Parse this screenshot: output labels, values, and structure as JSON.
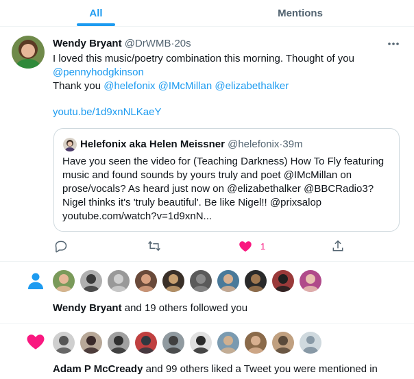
{
  "tabs": [
    {
      "label": "All",
      "active": true
    },
    {
      "label": "Mentions",
      "active": false
    }
  ],
  "colors": {
    "accent": "#1d9bf0",
    "like": "#f91880",
    "secondary_text": "#536471",
    "border": "#cfd9de"
  },
  "tweet": {
    "author_name": "Wendy Bryant",
    "author_handle": "@DrWMB",
    "dot": "·",
    "time": "20s",
    "line1": "I loved this music/poetry combination this morning. Thought of you",
    "mention_penny": "@pennyhodgkinson",
    "thank_you": "Thank you",
    "mention_helefonix": "@helefonix",
    "mention_imcmillan": "@IMcMillan",
    "mention_elizabeth": "@elizabethalker",
    "link": "youtu.be/1d9xnNLKaeY",
    "like_count": "1",
    "icons": [
      "more-icon",
      "reply-icon",
      "retweet-icon",
      "heart-filled-icon",
      "share-icon"
    ]
  },
  "quote": {
    "author_name": "Helefonix aka Helen Meissner",
    "author_handle": "@helefonix",
    "dot": "·",
    "time": "39m",
    "lines": [
      "Have you seen the video for (Teaching Darkness) How To Fly featuring",
      "music and found sounds by yours truly and poet @IMcMillan on",
      "prose/vocals? As heard just now on @elizabethalker @BBCRadio3?",
      "Nigel thinks it's 'truly beautiful'. Be like Nigel!! @prixsalop",
      "youtube.com/watch?v=1d9xnN..."
    ]
  },
  "follow_notification": {
    "icon": "person-icon",
    "name": "Wendy Bryant",
    "rest": "and 19 others followed you",
    "avatar_count": 10
  },
  "like_notification": {
    "icon": "heart-icon",
    "name": "Adam P McCready",
    "rest": "and 99 others liked a Tweet you were mentioned in",
    "avatar_count": 10
  }
}
